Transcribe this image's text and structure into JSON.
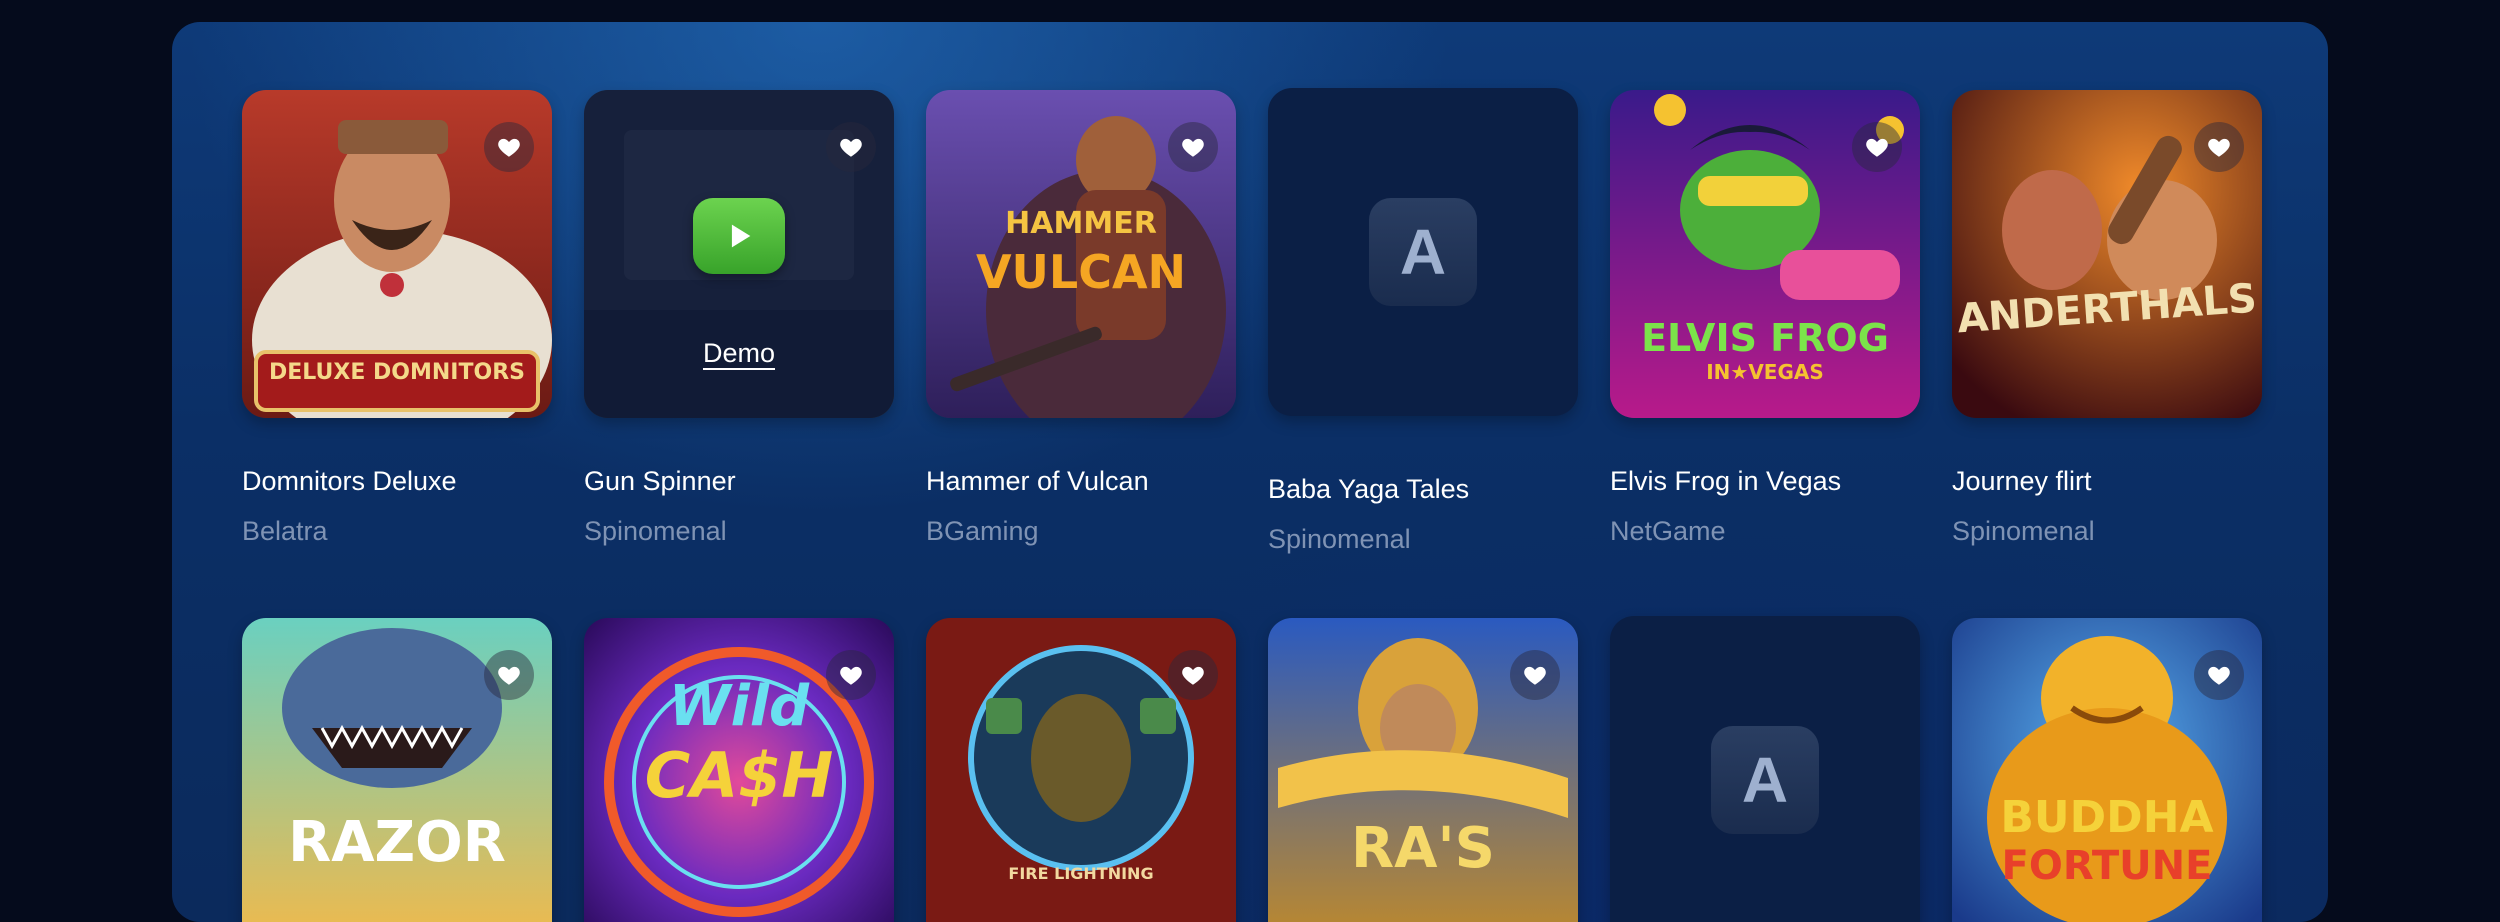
{
  "colors": {
    "panel_bg": "#0b2f66",
    "page_bg": "#050b1c",
    "title_text": "#ffffff",
    "provider_text": "#7f93b4",
    "demo_button": "#4cc23a"
  },
  "games_row1": [
    {
      "title": "Domnitors Deluxe",
      "provider": "Belatra",
      "art_label": "DELUXE DOMNITORS",
      "favorite_icon": "heart-icon"
    },
    {
      "title": "Gun Spinner",
      "provider": "Spinomenal",
      "demo_label": "Demo",
      "favorite_icon": "heart-icon",
      "play_icon": "play-icon"
    },
    {
      "title": "Hammer of Vulcan",
      "provider": "BGaming",
      "art_label_1": "HAMMER",
      "art_label_2": "VULCAN",
      "favorite_icon": "heart-icon"
    },
    {
      "title": "Baba Yaga Tales",
      "provider": "Spinomenal",
      "placeholder_letter": "A"
    },
    {
      "title": "Elvis Frog in Vegas",
      "provider": "NetGame",
      "art_label_1": "ELVIS FROG",
      "art_label_2": "IN★VEGAS",
      "favorite_icon": "heart-icon"
    },
    {
      "title": "Journey flirt",
      "provider": "Spinomenal",
      "art_label": "ANDERTHALS",
      "favorite_icon": "heart-icon"
    }
  ],
  "games_row2": [
    {
      "art_label": "RAZOR",
      "favorite_icon": "heart-icon"
    },
    {
      "art_label_1": "Wild",
      "art_label_2": "CA$H",
      "favorite_icon": "heart-icon"
    },
    {
      "art_label": "FIRE LIGHTNING",
      "favorite_icon": "heart-icon"
    },
    {
      "art_label": "RA'S",
      "favorite_icon": "heart-icon"
    },
    {
      "placeholder_letter": "A"
    },
    {
      "art_label_1": "BUDDHA",
      "art_label_2": "FORTUNE",
      "favorite_icon": "heart-icon"
    }
  ]
}
